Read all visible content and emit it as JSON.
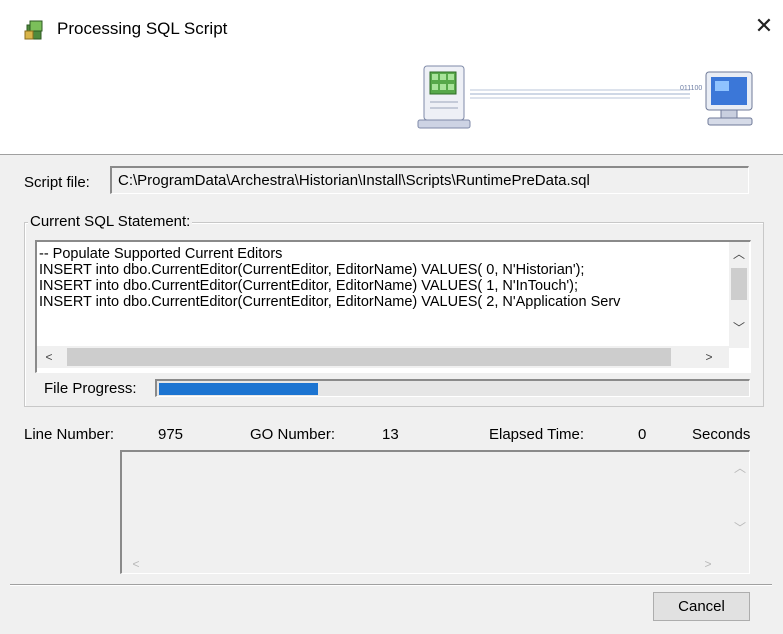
{
  "window": {
    "title": "Processing SQL Script",
    "close_glyph": "✕"
  },
  "banner": {
    "left_icon": "server-icon",
    "right_icon": "computer-icon",
    "line_text": "011100"
  },
  "script_file": {
    "label": "Script file:",
    "value": "C:\\ProgramData\\Archestra\\Historian\\Install\\Scripts\\RuntimePreData.sql"
  },
  "current_statement": {
    "label": "Current SQL Statement:",
    "lines": [
      "-- Populate Supported Current Editors",
      "INSERT into dbo.CurrentEditor(CurrentEditor, EditorName) VALUES( 0, N'Historian');",
      "INSERT into dbo.CurrentEditor(CurrentEditor, EditorName) VALUES( 1, N'InTouch');",
      "INSERT into dbo.CurrentEditor(CurrentEditor, EditorName) VALUES( 2, N'Application Serv"
    ]
  },
  "file_progress": {
    "label": "File Progress:",
    "fraction": 0.27
  },
  "stats": {
    "line_number_label": "Line Number:",
    "line_number_value": "975",
    "go_number_label": "GO Number:",
    "go_number_value": "13",
    "elapsed_label": "Elapsed Time:",
    "elapsed_value": "0",
    "elapsed_unit": "Seconds"
  },
  "buttons": {
    "cancel": "Cancel"
  },
  "colors": {
    "progress_fill": "#1c74d1",
    "dialog_bg": "#f0f0f0"
  }
}
